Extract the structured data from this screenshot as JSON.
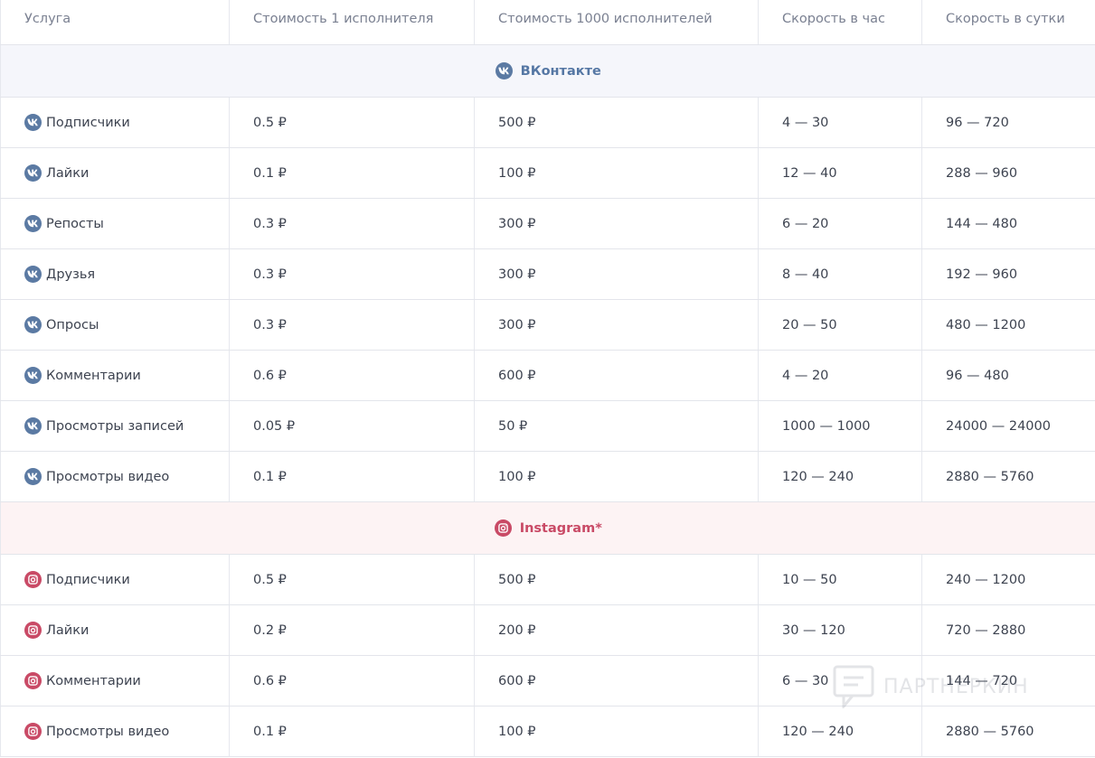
{
  "table": {
    "headers": [
      "Услуга",
      "Стоимость 1 исполнителя",
      "Стоимость 1000 исполнителей",
      "Скорость в час",
      "Скорость в сутки"
    ]
  },
  "groups": [
    {
      "name": "ВКонтакте",
      "icon": "vk-icon",
      "color": "#5b7aa3",
      "rows": [
        {
          "service": "Подписчики",
          "price_one": "0.5 ₽",
          "price_thousand": "500 ₽",
          "speed_hour": "4 — 30",
          "speed_day": "96 — 720"
        },
        {
          "service": "Лайки",
          "price_one": "0.1 ₽",
          "price_thousand": "100 ₽",
          "speed_hour": "12 — 40",
          "speed_day": "288 — 960"
        },
        {
          "service": "Репосты",
          "price_one": "0.3 ₽",
          "price_thousand": "300 ₽",
          "speed_hour": "6 — 20",
          "speed_day": "144 — 480"
        },
        {
          "service": "Друзья",
          "price_one": "0.3 ₽",
          "price_thousand": "300 ₽",
          "speed_hour": "8 — 40",
          "speed_day": "192 — 960"
        },
        {
          "service": "Опросы",
          "price_one": "0.3 ₽",
          "price_thousand": "300 ₽",
          "speed_hour": "20 — 50",
          "speed_day": "480 — 1200"
        },
        {
          "service": "Комментарии",
          "price_one": "0.6 ₽",
          "price_thousand": "600 ₽",
          "speed_hour": "4 — 20",
          "speed_day": "96 — 480"
        },
        {
          "service": "Просмотры записей",
          "price_one": "0.05 ₽",
          "price_thousand": "50 ₽",
          "speed_hour": "1000 — 1000",
          "speed_day": "24000 — 24000"
        },
        {
          "service": "Просмотры видео",
          "price_one": "0.1 ₽",
          "price_thousand": "100 ₽",
          "speed_hour": "120 — 240",
          "speed_day": "2880 — 5760"
        }
      ]
    },
    {
      "name": "Instagram*",
      "icon": "instagram-icon",
      "color": "#c94a66",
      "rows": [
        {
          "service": "Подписчики",
          "price_one": "0.5 ₽",
          "price_thousand": "500 ₽",
          "speed_hour": "10 — 50",
          "speed_day": "240 — 1200"
        },
        {
          "service": "Лайки",
          "price_one": "0.2 ₽",
          "price_thousand": "200 ₽",
          "speed_hour": "30 — 120",
          "speed_day": "720 — 2880"
        },
        {
          "service": "Комментарии",
          "price_one": "0.6 ₽",
          "price_thousand": "600 ₽",
          "speed_hour": "6 — 30",
          "speed_day": "144 — 720"
        },
        {
          "service": "Просмотры видео",
          "price_one": "0.1 ₽",
          "price_thousand": "100 ₽",
          "speed_hour": "120 — 240",
          "speed_day": "2880 — 5760"
        }
      ]
    }
  ],
  "watermark": {
    "text": "ПАРТНЕРКИН"
  }
}
